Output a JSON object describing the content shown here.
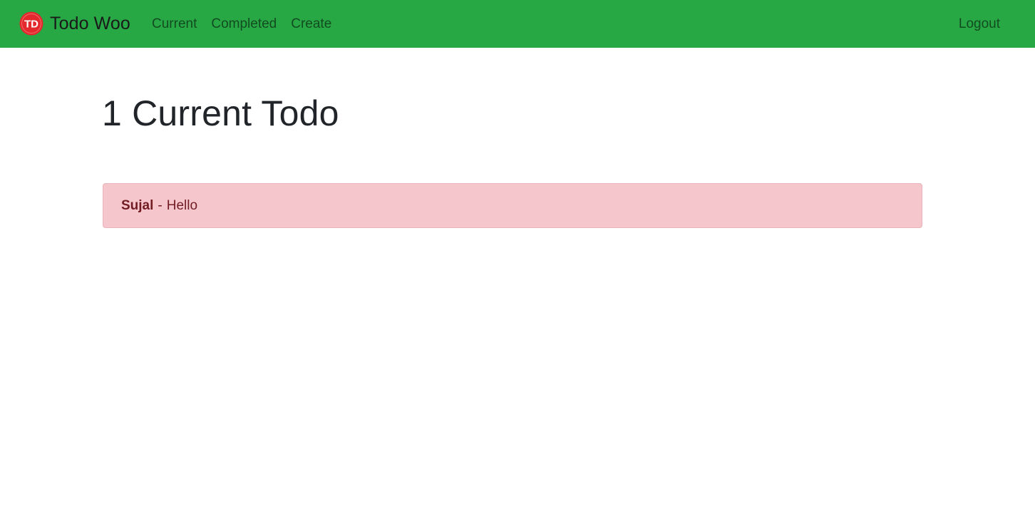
{
  "navbar": {
    "brand": {
      "name": "Todo Woo",
      "logo_text": "TD",
      "logo_icon": "todo-woo-logo-icon"
    },
    "links": [
      {
        "label": "Current"
      },
      {
        "label": "Completed"
      },
      {
        "label": "Create"
      }
    ],
    "logout_label": "Logout",
    "colors": {
      "background": "#28a745",
      "logo_red": "#e3292d"
    }
  },
  "main": {
    "title": "1 Current Todo",
    "todos": [
      {
        "title": "Sujal",
        "separator": "-",
        "memo": "Hello",
        "colors": {
          "background": "#f5c6cb",
          "text": "#721c24"
        }
      }
    ]
  }
}
